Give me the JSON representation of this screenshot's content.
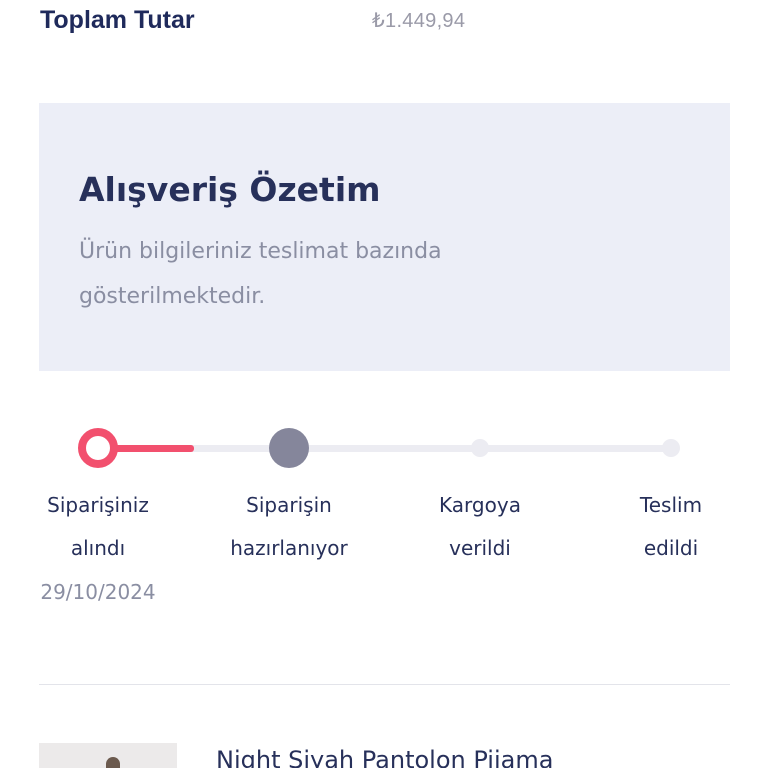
{
  "order_total": {
    "label": "Toplam Tutar",
    "value": "₺1.449,94"
  },
  "summary": {
    "title": "Alışveriş Özetim",
    "description": "Ürün bilgileriniz teslimat bazında gösterilmektedir."
  },
  "progress": {
    "steps": [
      {
        "label_line1": "Siparişiniz",
        "label_line2": "alındı",
        "date": "29/10/2024",
        "state": "completed"
      },
      {
        "label_line1": "Siparişin",
        "label_line2": "hazırlanıyor",
        "date": "",
        "state": "current"
      },
      {
        "label_line1": "Kargoya",
        "label_line2": "verildi",
        "date": "",
        "state": "pending"
      },
      {
        "label_line1": "Teslim",
        "label_line2": "edildi",
        "date": "",
        "state": "pending"
      }
    ]
  },
  "product": {
    "name": "Night Siyah Pantolon Pijama"
  },
  "colors": {
    "accent": "#f2506e",
    "navy": "#27305a",
    "muted": "#8a8ea2",
    "card_bg": "#eceef7",
    "current_step": "#85869b"
  }
}
